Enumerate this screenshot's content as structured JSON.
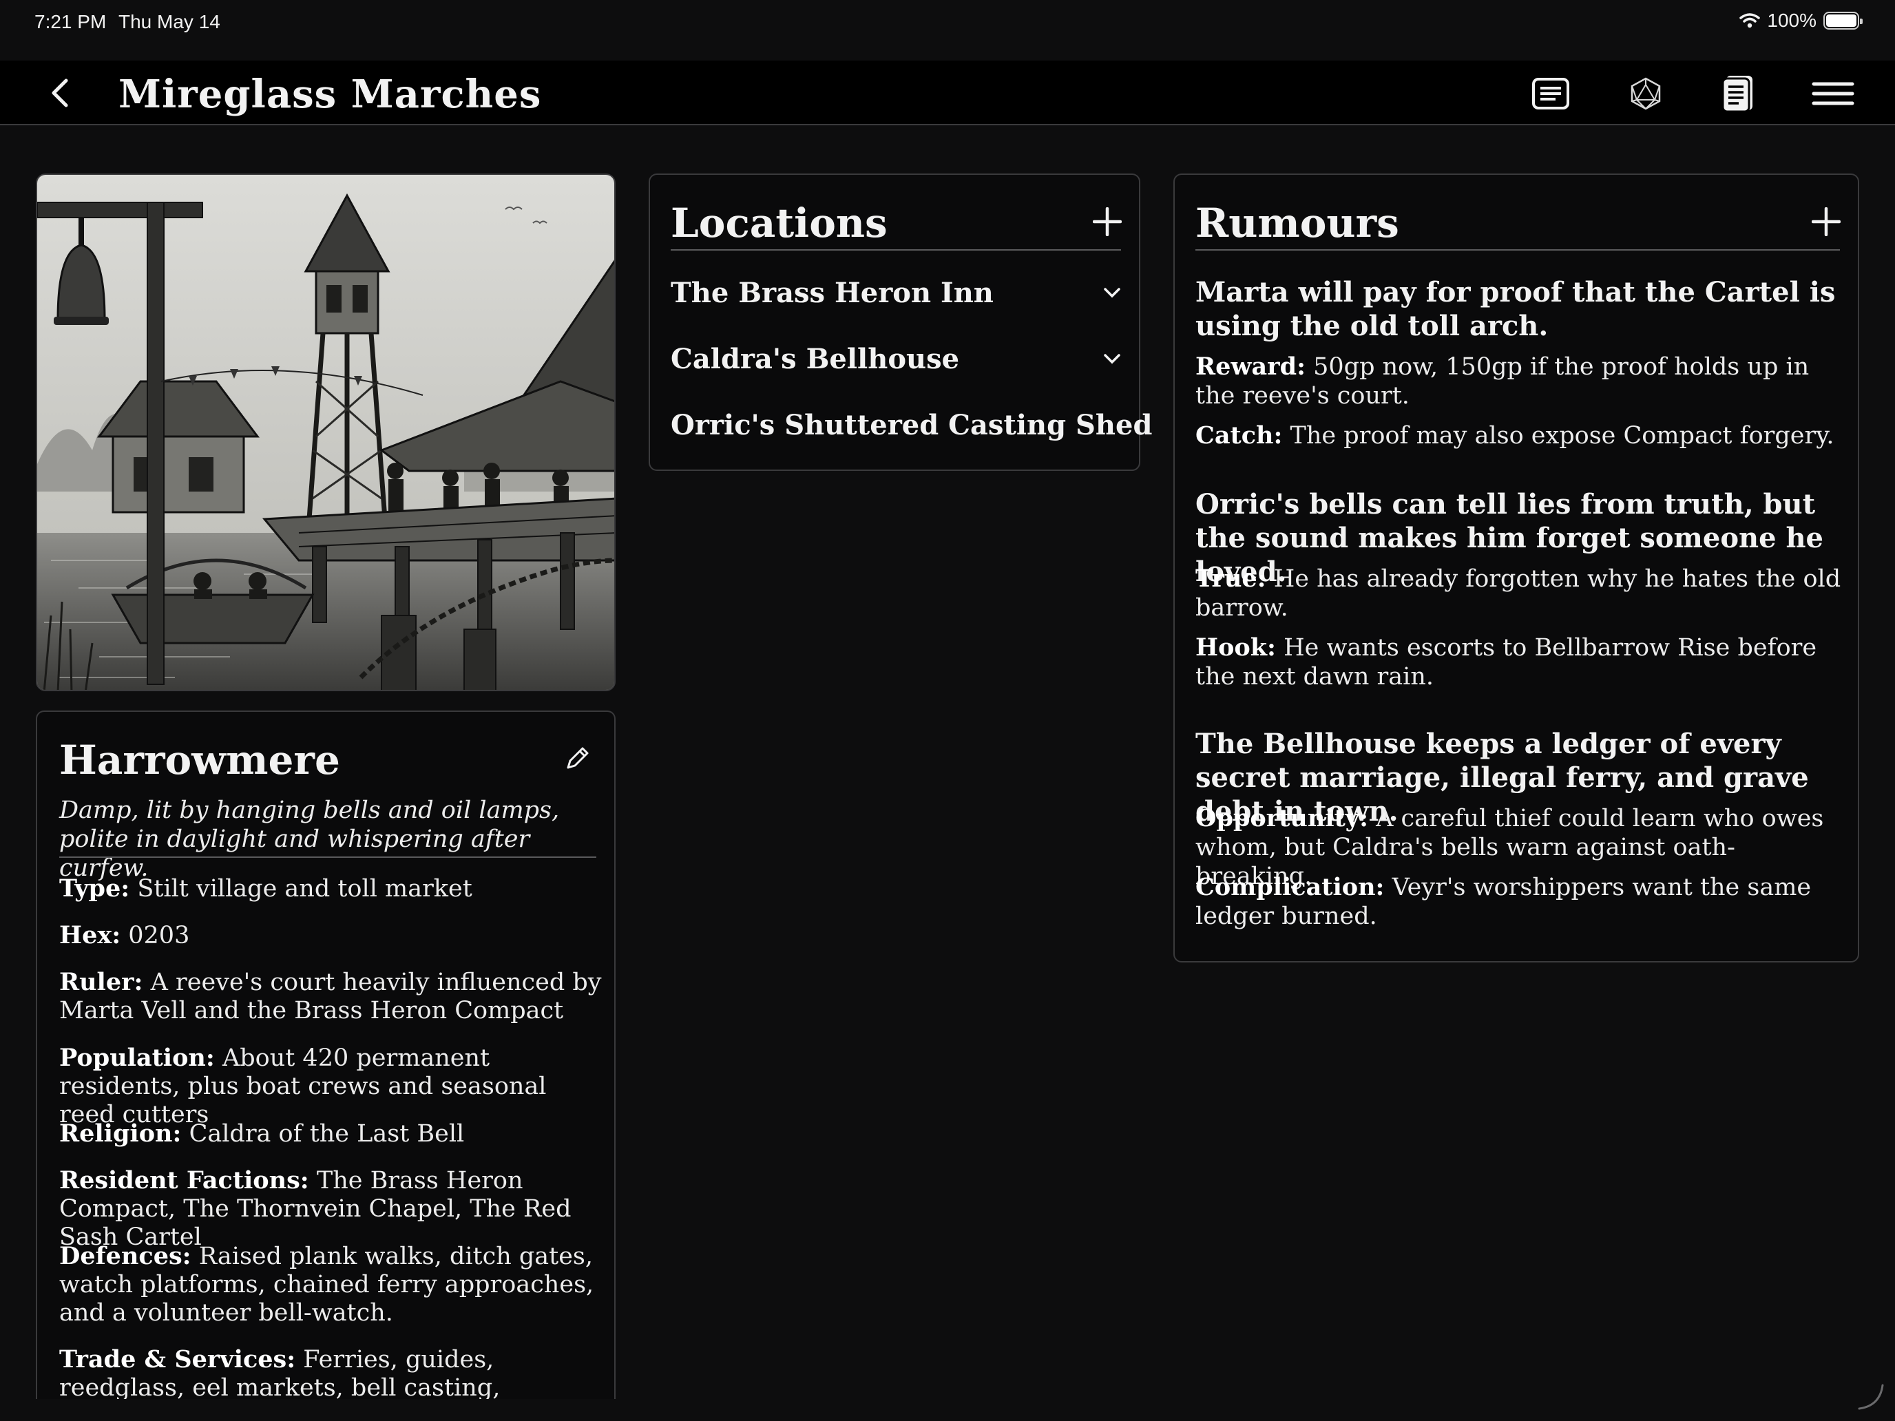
{
  "status": {
    "time": "7:21 PM",
    "date": "Thu May 14",
    "battery": "100%"
  },
  "header": {
    "title": "Mireglass Marches",
    "tools": [
      "notes-icon",
      "dice-icon",
      "journal-icon",
      "menu-icon"
    ]
  },
  "settlement": {
    "name": "Harrowmere",
    "description": "Damp, lit by hanging bells and oil lamps, polite in daylight and whispering after curfew.",
    "fields": [
      {
        "label": "Type:",
        "value": "Stilt village and toll market"
      },
      {
        "label": "Hex:",
        "value": "0203"
      },
      {
        "label": "Ruler:",
        "value": "A reeve's court heavily influenced by Marta Vell and the Brass Heron Compact"
      },
      {
        "label": "Population:",
        "value": "About 420 permanent residents, plus boat crews and seasonal reed cutters"
      },
      {
        "label": "Religion:",
        "value": "Caldra of the Last Bell"
      },
      {
        "label": "Resident Factions:",
        "value": "The Brass Heron Compact, The Thornvein Chapel, The Red Sash Cartel"
      },
      {
        "label": "Defences:",
        "value": "Raised plank walks, ditch gates, watch platforms, chained ferry approaches, and a volunteer bell-watch."
      },
      {
        "label": "Trade & Services:",
        "value": "Ferries, guides, reedglass, eel markets, bell casting, common lodging."
      }
    ]
  },
  "locations": {
    "title": "Locations",
    "items": [
      {
        "label": "The Brass Heron Inn"
      },
      {
        "label": "Caldra's Bellhouse"
      },
      {
        "label": "Orric's Shuttered Casting Shed"
      }
    ]
  },
  "rumours": {
    "title": "Rumours",
    "items": [
      {
        "headline": "Marta will pay for proof that the Cartel is using the old toll arch.",
        "details": [
          {
            "label": "Reward:",
            "value": "50gp now, 150gp if the proof holds up in the reeve's court."
          },
          {
            "label": "Catch:",
            "value": "The proof may also expose Compact forgery."
          }
        ]
      },
      {
        "headline": "Orric's bells can tell lies from truth, but the sound makes him forget someone he loved.",
        "details": [
          {
            "label": "True:",
            "value": "He has already forgotten why he hates the old barrow."
          },
          {
            "label": "Hook:",
            "value": "He wants escorts to Bellbarrow Rise before the next dawn rain."
          }
        ]
      },
      {
        "headline": "The Bellhouse keeps a ledger of every secret marriage, illegal ferry, and grave debt in town.",
        "details": [
          {
            "label": "Opportunity:",
            "value": "A careful thief could learn who owes whom, but Caldra's bells warn against oath-breaking."
          },
          {
            "label": "Complication:",
            "value": "Veyr's worshippers want the same ledger burned."
          }
        ]
      }
    ]
  }
}
